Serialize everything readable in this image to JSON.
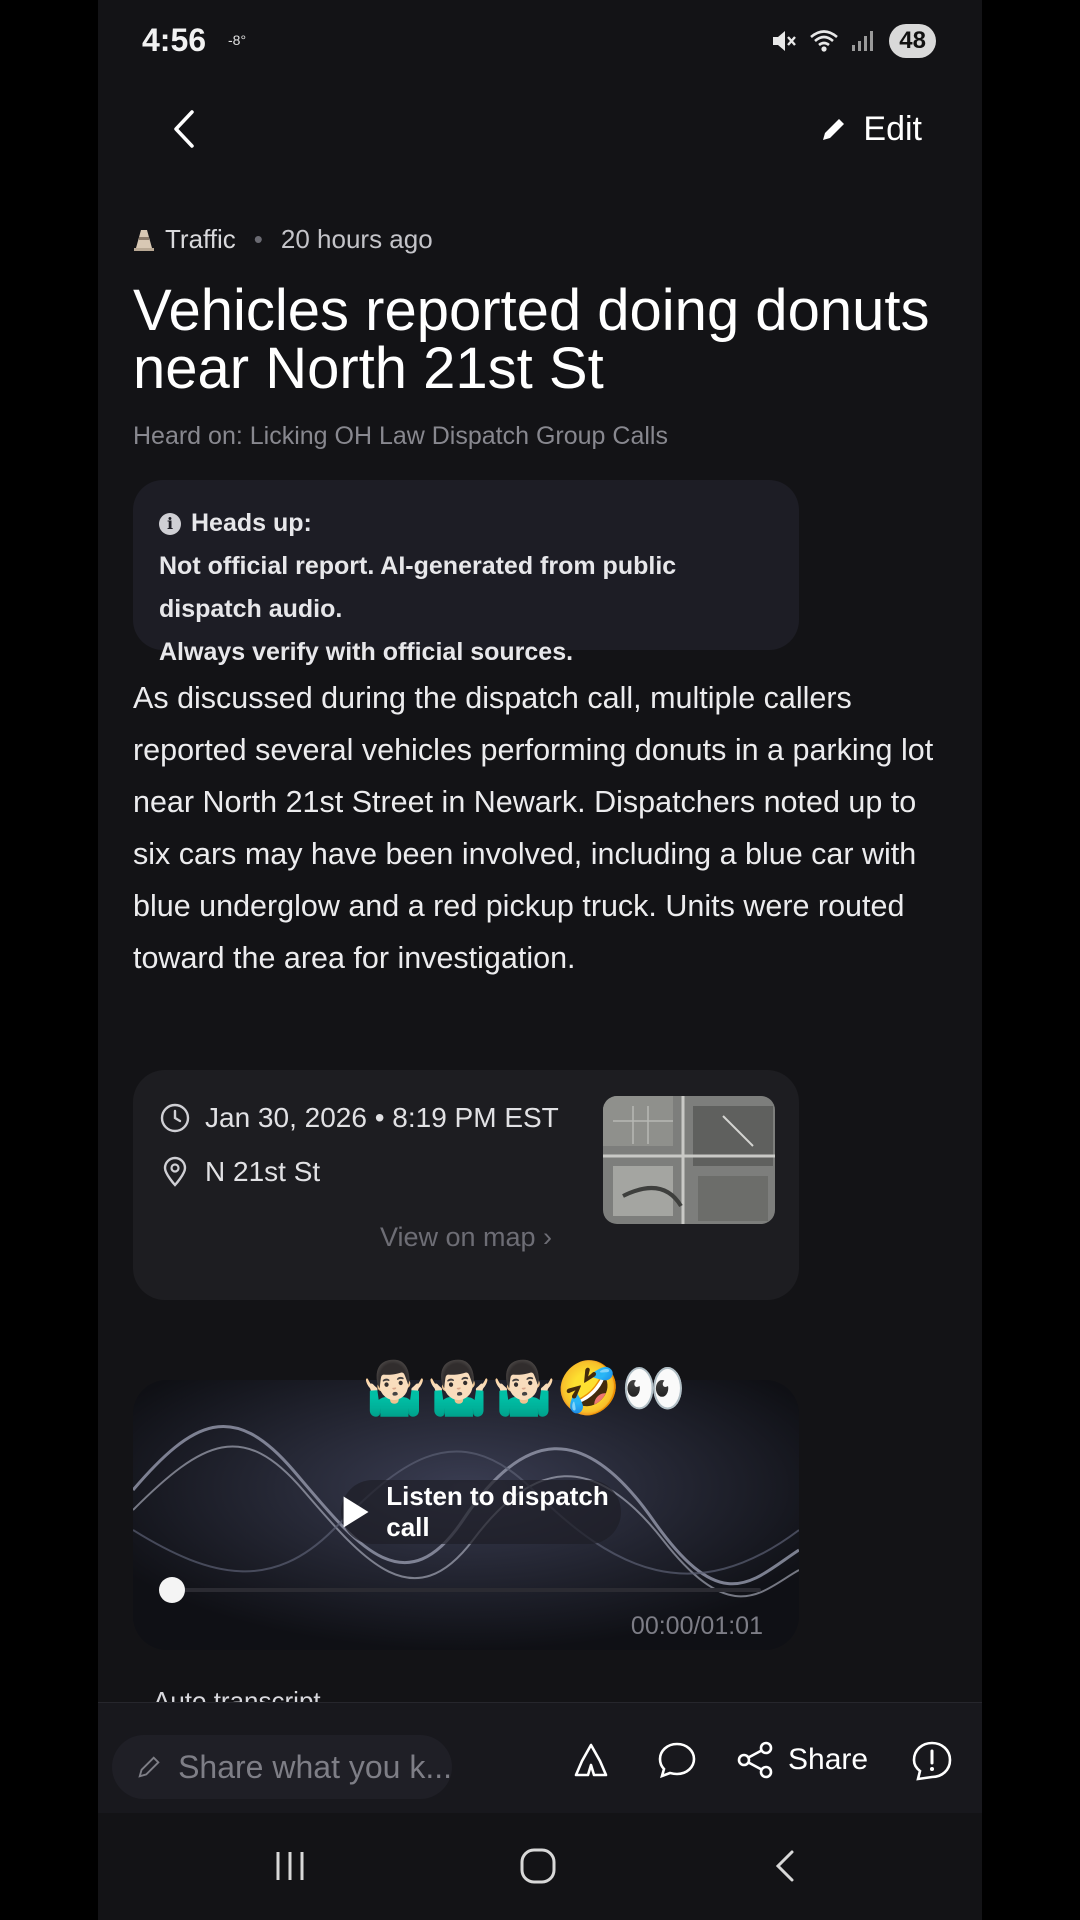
{
  "status_bar": {
    "time": "4:56",
    "temperature": "-8°",
    "battery": "48"
  },
  "top_bar": {
    "edit_label": "Edit"
  },
  "article": {
    "category": "Traffic",
    "category_icon": "traffic-cone-icon",
    "time_ago": "20 hours ago",
    "title": "Vehicles reported doing donuts near North 21st St",
    "heard_on": "Heard on: Licking OH Law Dispatch Group Calls",
    "notice": {
      "heading": "Heads up:",
      "line1": "Not official report. AI-generated from public dispatch audio.",
      "line2": "Always verify with official sources."
    },
    "body": "As discussed during the dispatch call, multiple callers reported several vehicles performing donuts in a parking lot near North 21st Street in Newark. Dispatchers noted up to six cars may have been involved, including a blue car with blue underglow and a red pickup truck. Units were routed toward the area for investigation."
  },
  "details": {
    "datetime": "Jan 30, 2026 • 8:19 PM EST",
    "location": "N 21st St",
    "view_map_label": "View on map"
  },
  "overlay_emoji": "🤷🏻‍♂️🤷🏻‍♂️🤷🏻‍♂️🤣👀",
  "audio": {
    "listen_label": "Listen to dispatch call",
    "duration": "00:00/01:01",
    "progress": 0
  },
  "transcript_label": "Auto transcript",
  "bottom_bar": {
    "share_placeholder": "Share what you k...",
    "share_label": "Share"
  }
}
